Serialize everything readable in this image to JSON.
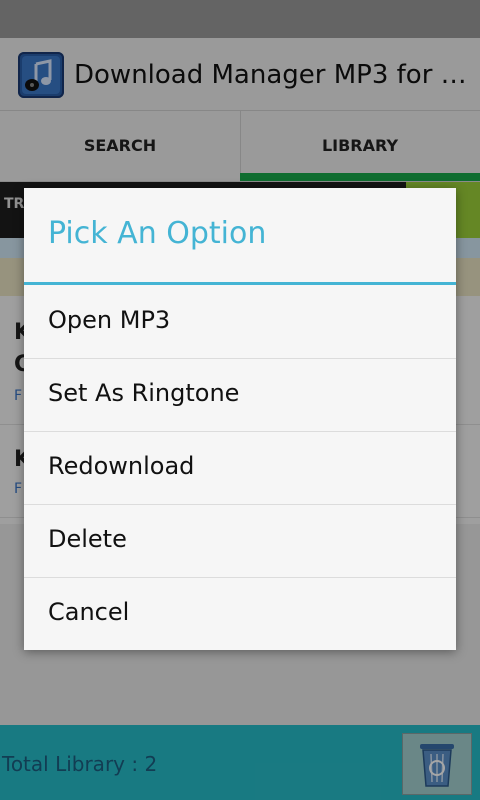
{
  "app": {
    "title": "Download Manager MP3 for An..."
  },
  "tabs": [
    {
      "label": "SEARCH"
    },
    {
      "label": "LIBRARY"
    }
  ],
  "ad": {
    "text": "TR"
  },
  "list": {
    "items": [
      {
        "title": "K",
        "line2": "C",
        "sub": "F"
      },
      {
        "title": "K",
        "sub": "F"
      }
    ]
  },
  "footer": {
    "total_label": "Total Library : 2"
  },
  "dialog": {
    "title": "Pick An Option",
    "options": [
      "Open MP3",
      "Set As Ringtone",
      "Redownload",
      "Delete",
      "Cancel"
    ]
  },
  "colors": {
    "accent": "#44b4d4",
    "tab_indicator": "#17a84a",
    "footer": "#26bcc8"
  },
  "icons": {
    "app": "music-note-icon",
    "trash": "recycle-trash-icon"
  }
}
